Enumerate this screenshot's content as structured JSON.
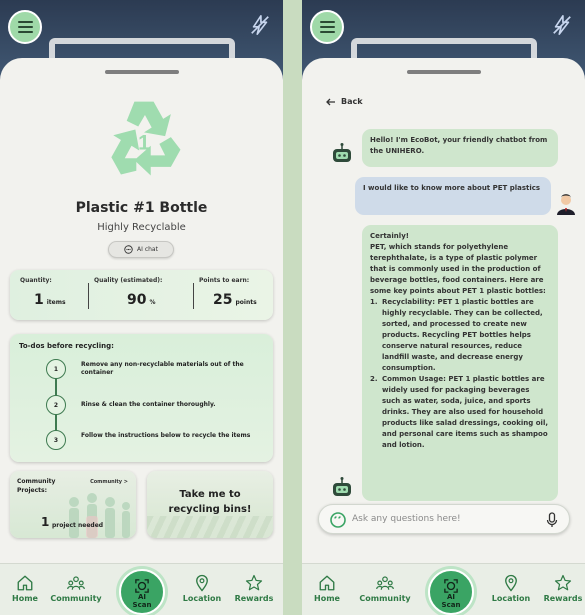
{
  "screen1": {
    "product_title": "Plastic #1 Bottle",
    "product_subtitle": "Highly Recyclable",
    "ai_chat_label": "AI chat",
    "stats": {
      "quantity_label": "Quantity:",
      "quantity_value": "1",
      "quantity_unit": "items",
      "quality_label": "Quality (estimated):",
      "quality_value": "90",
      "quality_unit": "%",
      "points_label": "Points to earn:",
      "points_value": "25",
      "points_unit": "points"
    },
    "todo": {
      "title": "To-dos before recycling:",
      "steps": [
        {
          "num": "1",
          "text": "Remove any non-recyclable materials out of the container"
        },
        {
          "num": "2",
          "text": "Rinse & clean the container thoroughly."
        },
        {
          "num": "3",
          "text": "Follow the instructions below to recycle the items"
        }
      ]
    },
    "community": {
      "title": "Community Projects:",
      "link": "Community >",
      "count": "1",
      "count_label": "project needed"
    },
    "takeme": {
      "text": "Take me to recycling bins!"
    }
  },
  "screen2": {
    "back_label": "Back",
    "messages": {
      "bot_intro": "Hello! I'm EcoBot, your friendly chatbot from the UNIHERO.",
      "user_question": "I would like to know more about PET plastics",
      "bot_answer_intro": "Certainly!",
      "bot_answer_body": "PET, which stands for polyethylene terephthalate, is a type of plastic polymer that is commonly used in the production of beverage bottles, food containers. Here are some key points about PET 1 plastic bottles:",
      "bot_answer_point1_num": "1.",
      "bot_answer_point1": "Recyclability: PET 1 plastic bottles are highly recyclable. They can be collected, sorted, and processed to create new products. Recycling PET bottles helps conserve natural resources, reduce landfill waste, and decrease energy consumption.",
      "bot_answer_point2_num": "2.",
      "bot_answer_point2": "Common Usage: PET 1 plastic bottles are widely used for packaging beverages such as water, soda, juice, and sports drinks. They are also used for household products like salad dressings, cooking oil, and personal care items such as shampoo and lotion."
    },
    "input_placeholder": "Ask any questions here!"
  },
  "nav": {
    "home": "Home",
    "community": "Community",
    "scan_line1": "AI",
    "scan_line2": "Scan",
    "location": "Location",
    "rewards": "Rewards"
  },
  "colors": {
    "accent_green": "#3aa464",
    "nav_label_green": "#2f7a45",
    "bot_bubble": "#cfe6cd",
    "user_bubble": "#cfdbe9"
  },
  "icons": {
    "menu": "hamburger-icon",
    "flash": "flash-off-icon",
    "recycle": "recycle-1-icon",
    "chat": "chat-bubble-icon",
    "back": "arrow-left-icon",
    "bot": "robot-icon",
    "user": "user-avatar-icon",
    "mic": "microphone-icon",
    "home": "home-icon",
    "community": "people-icon",
    "scan": "scan-icon",
    "location": "location-pin-icon",
    "rewards": "star-icon"
  }
}
